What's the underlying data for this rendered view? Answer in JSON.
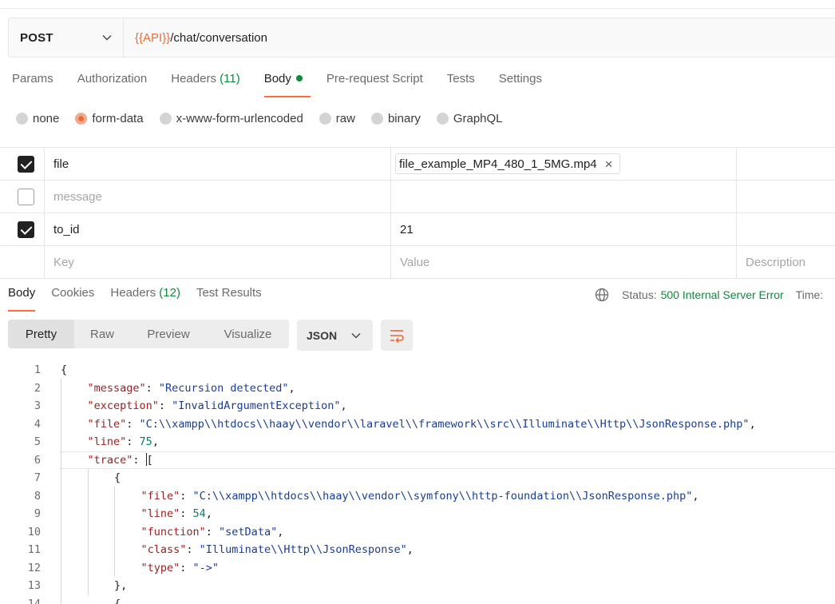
{
  "request": {
    "method": "POST",
    "url_var": "{{API}}",
    "url_path": "/chat/conversation"
  },
  "req_tabs": [
    {
      "label": "Params"
    },
    {
      "label": "Authorization"
    },
    {
      "label": "Headers",
      "count": "(11)"
    },
    {
      "label": "Body"
    },
    {
      "label": "Pre-request Script"
    },
    {
      "label": "Tests"
    },
    {
      "label": "Settings"
    }
  ],
  "body_types": [
    "none",
    "form-data",
    "x-www-form-urlencoded",
    "raw",
    "binary",
    "GraphQL"
  ],
  "body_type_selected": "form-data",
  "form_rows": [
    {
      "key": "file",
      "value": "file_example_MP4_480_1_5MG.mp4",
      "checked": true
    },
    {
      "key": "message",
      "value": "",
      "checked": false
    },
    {
      "key": "to_id",
      "value": "21",
      "checked": true
    }
  ],
  "placeholders": {
    "key": "Key",
    "value": "Value",
    "description": "Description"
  },
  "resp_tabs": [
    {
      "label": "Body"
    },
    {
      "label": "Cookies"
    },
    {
      "label": "Headers",
      "count": "(12)"
    },
    {
      "label": "Test Results"
    }
  ],
  "status": {
    "label": "Status:",
    "value": "500 Internal Server Error",
    "time_label": "Time:"
  },
  "view_modes": [
    "Pretty",
    "Raw",
    "Preview",
    "Visualize"
  ],
  "format": "JSON",
  "code_lines": [
    {
      "n": "1",
      "text": "{"
    },
    {
      "n": "2",
      "text": "\"message\": \"Recursion detected\","
    },
    {
      "n": "3",
      "text": "\"exception\": \"InvalidArgumentException\","
    },
    {
      "n": "4",
      "text": "\"file\": \"C:\\\\xampp\\\\htdocs\\\\haay\\\\vendor\\\\laravel\\\\framework\\\\src\\\\Illuminate\\\\Http\\\\JsonResponse.php\","
    },
    {
      "n": "5",
      "text": "\"line\": 75,"
    },
    {
      "n": "6",
      "text": "\"trace\": ["
    },
    {
      "n": "7",
      "text": "{"
    },
    {
      "n": "8",
      "text": "\"file\": \"C:\\\\xampp\\\\htdocs\\\\haay\\\\vendor\\\\symfony\\\\http-foundation\\\\JsonResponse.php\","
    },
    {
      "n": "9",
      "text": "\"line\": 54,"
    },
    {
      "n": "10",
      "text": "\"function\": \"setData\","
    },
    {
      "n": "11",
      "text": "\"class\": \"Illuminate\\\\Http\\\\JsonResponse\","
    },
    {
      "n": "12",
      "text": "\"type\": \"->\""
    },
    {
      "n": "13",
      "text": "},"
    },
    {
      "n": "14",
      "text": "{"
    }
  ],
  "colors": {
    "accent": "#ff6c37",
    "success": "#0c8a3d",
    "url_var": "#e86f3c"
  }
}
